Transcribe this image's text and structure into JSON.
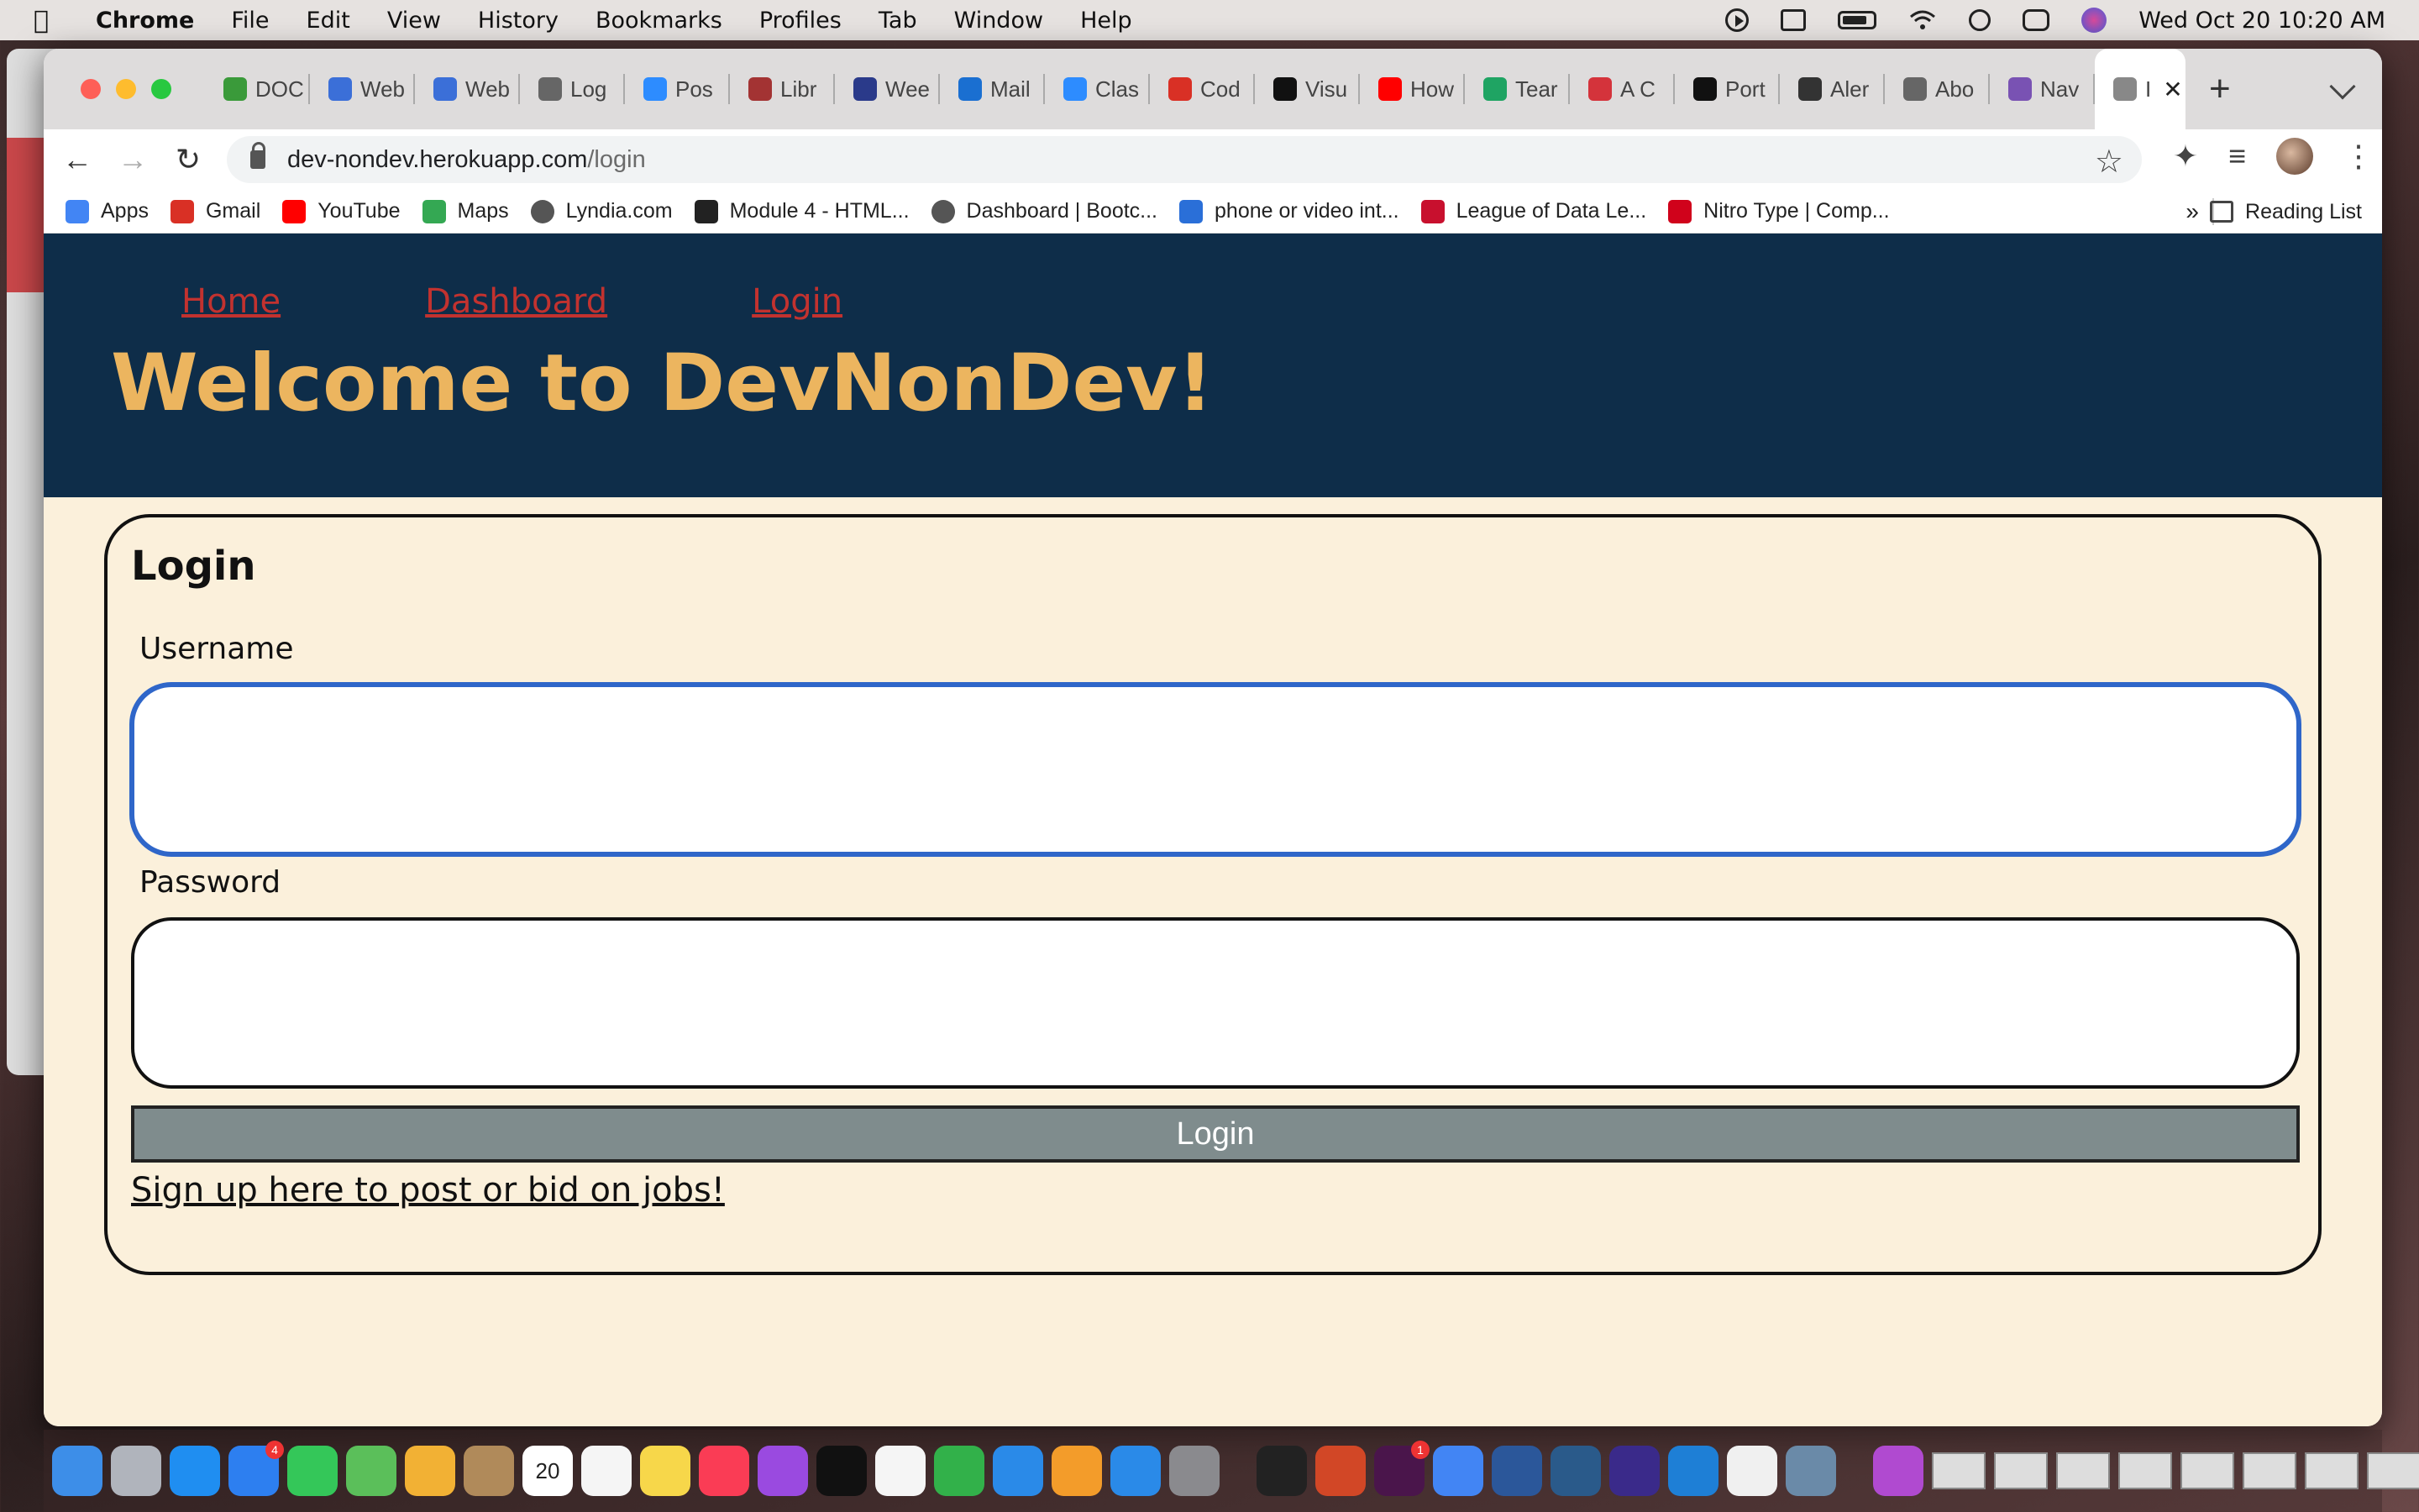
{
  "menubar": {
    "app_name": "Chrome",
    "items": [
      "File",
      "Edit",
      "View",
      "History",
      "Bookmarks",
      "Profiles",
      "Tab",
      "Window",
      "Help"
    ],
    "datetime": "Wed Oct 20  10:20 AM"
  },
  "tabs": [
    {
      "label": "DOC",
      "icon": "quill-icon",
      "color": "#3a9a3a"
    },
    {
      "label": "Web",
      "icon": "smile-icon",
      "color": "#3b6fd8"
    },
    {
      "label": "Web",
      "icon": "smile-icon",
      "color": "#3b6fd8"
    },
    {
      "label": "Log",
      "icon": "globe-icon",
      "color": "#666666"
    },
    {
      "label": "Pos",
      "icon": "zoom-icon",
      "color": "#2d8cff"
    },
    {
      "label": "Libr",
      "icon": "shield-icon",
      "color": "#a33333"
    },
    {
      "label": "Wee",
      "icon": "person-icon",
      "color": "#2a3a8a"
    },
    {
      "label": "Mail",
      "icon": "outlook-icon",
      "color": "#1a6fd1"
    },
    {
      "label": "Clas",
      "icon": "zoom-icon",
      "color": "#2d8cff"
    },
    {
      "label": "Cod",
      "icon": "gmail-icon",
      "color": "#d93025"
    },
    {
      "label": "Visu",
      "icon": "va-icon",
      "color": "#111111"
    },
    {
      "label": "How",
      "icon": "youtube-icon",
      "color": "#ff0000"
    },
    {
      "label": "Tear",
      "icon": "drive-icon",
      "color": "#1fa463"
    },
    {
      "label": "A C",
      "icon": "asterisk-icon",
      "color": "#d4333b"
    },
    {
      "label": "Port",
      "icon": "github-icon",
      "color": "#111111"
    },
    {
      "label": "Aler",
      "icon": "monitor-icon",
      "color": "#333333"
    },
    {
      "label": "Abo",
      "icon": "globe-icon",
      "color": "#666666"
    },
    {
      "label": "Nav",
      "icon": "bootstrap-icon",
      "color": "#7952b3"
    }
  ],
  "active_tab": {
    "label": "I",
    "icon": "globe-icon"
  },
  "url": {
    "host": "dev-nondev.herokuapp.com",
    "path": "/login"
  },
  "bookmarks": [
    {
      "label": "Apps",
      "icon": "apps-grid-icon",
      "color": "#4285f4"
    },
    {
      "label": "Gmail",
      "icon": "gmail-icon",
      "color": "#d93025"
    },
    {
      "label": "YouTube",
      "icon": "youtube-icon",
      "color": "#ff0000"
    },
    {
      "label": "Maps",
      "icon": "maps-pin-icon",
      "color": "#34a853"
    },
    {
      "label": "Lyndia.com",
      "icon": "globe-icon",
      "color": "#555555"
    },
    {
      "label": "Module 4 - HTML...",
      "icon": "book-icon",
      "color": "#222222"
    },
    {
      "label": "Dashboard | Bootc...",
      "icon": "globe-icon",
      "color": "#555555"
    },
    {
      "label": "phone or video int...",
      "icon": "video-icon",
      "color": "#2a6fd8"
    },
    {
      "label": "League of Data Le...",
      "icon": "league-icon",
      "color": "#c8102e"
    },
    {
      "label": "Nitro Type | Comp...",
      "icon": "nitro-icon",
      "color": "#d0021b"
    }
  ],
  "bookmarks_more": "»",
  "reading_list": "Reading List",
  "site": {
    "nav": [
      "Home",
      "Dashboard",
      "Login"
    ],
    "title": "Welcome to DevNonDev!"
  },
  "login_form": {
    "title": "Login",
    "username_label": "Username",
    "username_value": "",
    "password_label": "Password",
    "password_value": "",
    "submit_label": "Login",
    "signup_link": "Sign up here to post or bid on jobs!"
  },
  "dock": {
    "apps": [
      {
        "name": "finder-icon",
        "color": "#3d8ee8"
      },
      {
        "name": "launchpad-icon",
        "color": "#b0b4bc"
      },
      {
        "name": "safari-icon",
        "color": "#1f8ef1"
      },
      {
        "name": "mail-icon",
        "color": "#2d7ff0",
        "badge": "4"
      },
      {
        "name": "messages-icon",
        "color": "#34c759"
      },
      {
        "name": "maps-icon",
        "color": "#5bbf5a"
      },
      {
        "name": "photos-icon",
        "color": "#f2b134"
      },
      {
        "name": "contacts-icon",
        "color": "#b08a5a"
      },
      {
        "name": "calendar-icon",
        "color": "#ffffff",
        "text": "20"
      },
      {
        "name": "reminders-icon",
        "color": "#f5f5f5"
      },
      {
        "name": "notes-icon",
        "color": "#f7d74a"
      },
      {
        "name": "music-icon",
        "color": "#fa3c55"
      },
      {
        "name": "podcasts-icon",
        "color": "#9a4ae0"
      },
      {
        "name": "tv-icon",
        "color": "#111111"
      },
      {
        "name": "news-icon",
        "color": "#f5f5f5"
      },
      {
        "name": "numbers-icon",
        "color": "#32b14a"
      },
      {
        "name": "keynote-icon",
        "color": "#2a8ae8"
      },
      {
        "name": "pages-icon",
        "color": "#f39c2a"
      },
      {
        "name": "app-store-icon",
        "color": "#2a8ae8"
      },
      {
        "name": "system-preferences-icon",
        "color": "#8a8a8e"
      }
    ],
    "apps2": [
      {
        "name": "terminal-icon",
        "color": "#222222"
      },
      {
        "name": "powerpoint-icon",
        "color": "#d24726"
      },
      {
        "name": "slack-icon",
        "color": "#4a154b",
        "badge": "1"
      },
      {
        "name": "chrome-icon",
        "color": "#4285f4"
      },
      {
        "name": "word-icon",
        "color": "#2b579a"
      },
      {
        "name": "mysql-workbench-icon",
        "color": "#2a5a8a"
      },
      {
        "name": "eclipse-icon",
        "color": "#3a2a8a"
      },
      {
        "name": "vscode-icon",
        "color": "#1e7fd6"
      },
      {
        "name": "textedit-icon",
        "color": "#f0f0f0"
      },
      {
        "name": "preview-icon",
        "color": "#6a8aa8"
      }
    ],
    "apps3": [
      {
        "name": "time-machine-icon",
        "color": "#b04ad0"
      }
    ]
  }
}
